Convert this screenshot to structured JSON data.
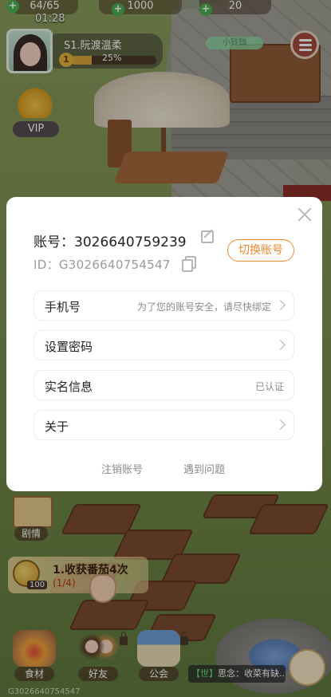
{
  "hud": {
    "resources": [
      {
        "icon": "energy-icon",
        "value": "64/65"
      },
      {
        "icon": "coin-icon",
        "value": "1000"
      },
      {
        "icon": "gem-icon",
        "value": "20"
      }
    ],
    "time": "01:28",
    "player": {
      "name": "S1.阮渡温柔",
      "level": "1",
      "progress_text": "25%",
      "progress": 0.25
    },
    "vip_label": "VIP",
    "status_tag": "小铃铛"
  },
  "bottom": {
    "story_label": "剧情",
    "quest": {
      "title": "1.收获番茄4次",
      "progress": "(1/4)",
      "reward": "100"
    },
    "buttons": [
      {
        "label": "食材",
        "icon": "basket-icon"
      },
      {
        "label": "好友",
        "icon": "friends-icon"
      },
      {
        "label": "公会",
        "icon": "guild-icon"
      }
    ],
    "chat": {
      "channel": "【世】",
      "text": "思念：收菜有缺..."
    },
    "uid_watermark": "G3026640754547"
  },
  "modal": {
    "account_label": "账号：",
    "account_number": "3026640759239",
    "id_label": "ID：",
    "id_value": "G3026640754547",
    "switch_button": "切换账号",
    "rows": [
      {
        "label": "手机号",
        "hint": "为了您的账号安全，请尽快绑定"
      },
      {
        "label": "设置密码",
        "hint": ""
      },
      {
        "label": "实名信息",
        "hint": "已认证"
      },
      {
        "label": "关于",
        "hint": ""
      }
    ],
    "footer": {
      "cancel_account": "注销账号",
      "help": "遇到问题"
    }
  },
  "colors": {
    "accent": "#f08a2a",
    "modal_bg": "#ffffff",
    "muted_text": "#8a8a8a"
  }
}
